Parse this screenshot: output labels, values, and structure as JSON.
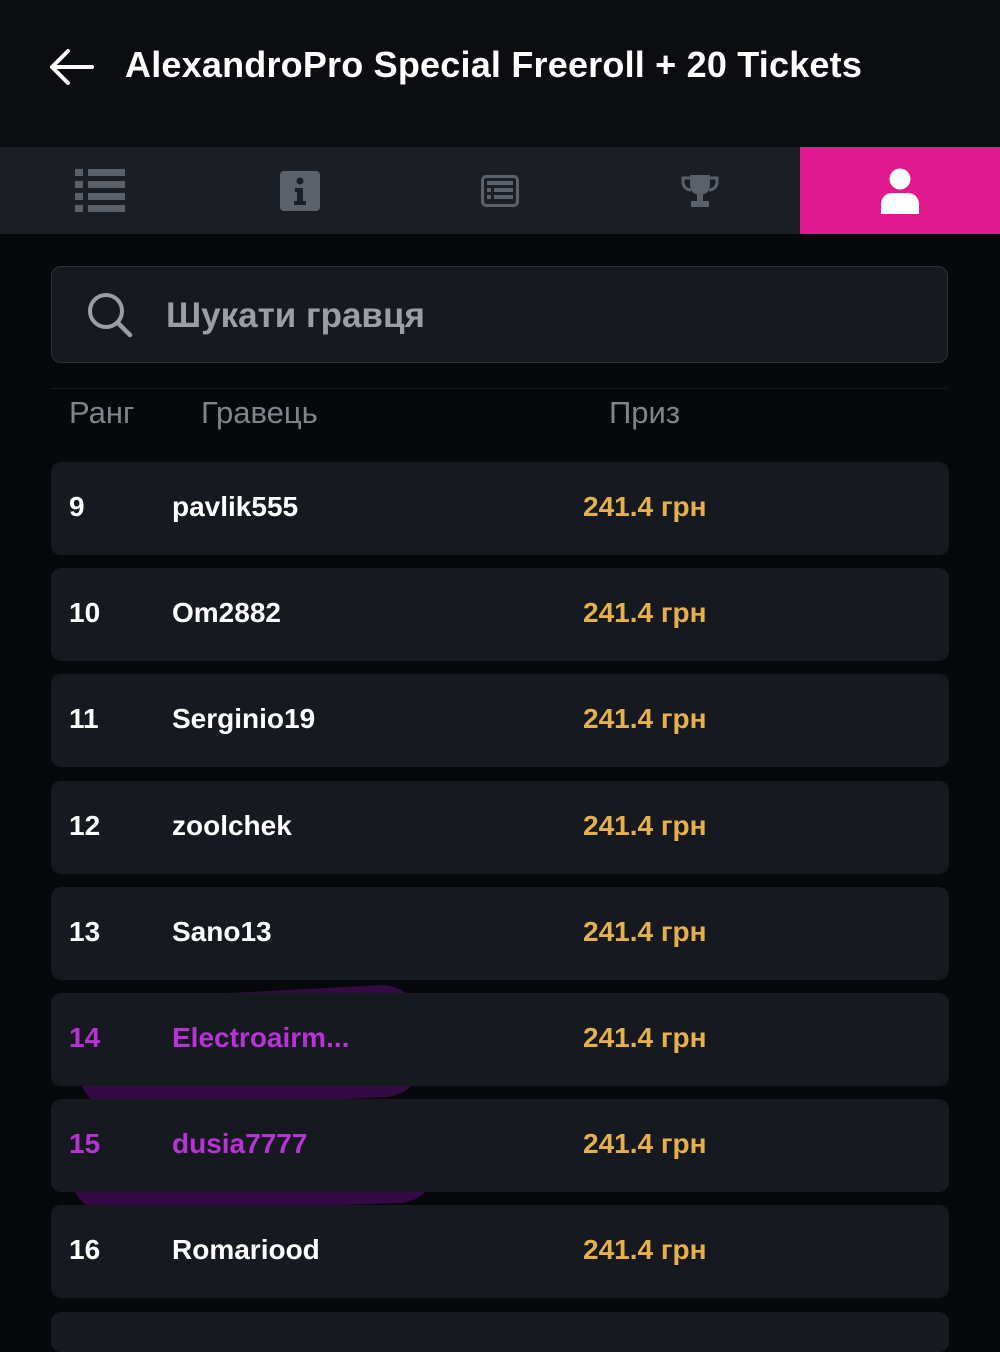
{
  "header": {
    "title": "AlexandroPro Special Freeroll + 20 Tickets"
  },
  "tabs": [
    {
      "icon": "list-icon",
      "active": false
    },
    {
      "icon": "info-icon",
      "active": false
    },
    {
      "icon": "structure-icon",
      "active": false
    },
    {
      "icon": "trophy-icon",
      "active": false
    },
    {
      "icon": "user-icon",
      "active": true
    }
  ],
  "colors": {
    "accent": "#e0198f",
    "prize": "#e6b04a",
    "highlight": "#b832d6",
    "row_bg": "#161a20"
  },
  "search": {
    "placeholder": "Шукати гравця"
  },
  "table": {
    "headers": {
      "rank": "Ранг",
      "player": "Гравець",
      "prize": "Приз"
    },
    "rows": [
      {
        "rank": "9",
        "player": "pavlik555",
        "prize": "241.4 грн"
      },
      {
        "rank": "10",
        "player": "Om2882",
        "prize": "241.4 грн"
      },
      {
        "rank": "11",
        "player": "Serginio19",
        "prize": "241.4 грн"
      },
      {
        "rank": "12",
        "player": "zoolchek",
        "prize": "241.4 грн"
      },
      {
        "rank": "13",
        "player": "Sano13",
        "prize": "241.4 грн"
      },
      {
        "rank": "14",
        "player": "Electroairm...",
        "prize": "241.4 грн"
      },
      {
        "rank": "15",
        "player": "dusia7777",
        "prize": "241.4 грн"
      },
      {
        "rank": "16",
        "player": "Romariood",
        "prize": "241.4 грн"
      }
    ]
  }
}
